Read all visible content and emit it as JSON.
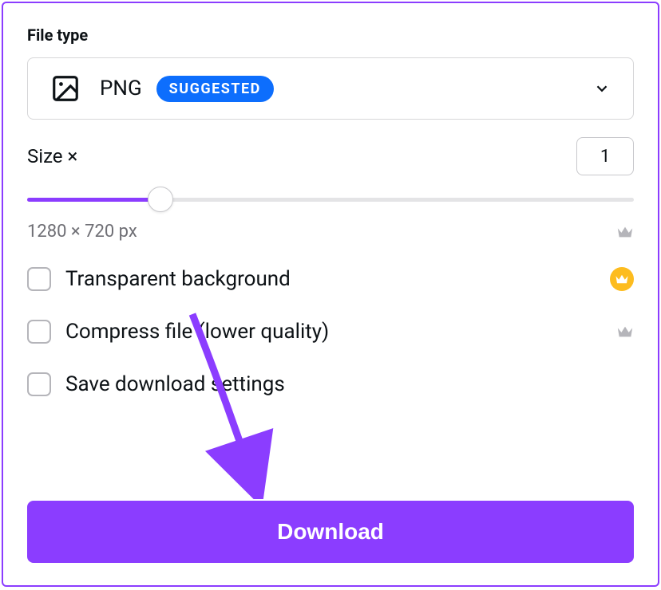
{
  "file_type": {
    "heading": "File type",
    "selected_label": "PNG",
    "badge": "SUGGESTED"
  },
  "size": {
    "label": "Size ×",
    "value": "1",
    "slider_percent": 22,
    "dimensions": "1280 × 720 px"
  },
  "options": {
    "transparent_bg": "Transparent background",
    "compress": "Compress file (lower quality)",
    "save_settings": "Save download settings"
  },
  "download_label": "Download",
  "colors": {
    "accent": "#8b3dff",
    "badge_blue": "#0d6efd",
    "gold": "#fdbc1f"
  }
}
